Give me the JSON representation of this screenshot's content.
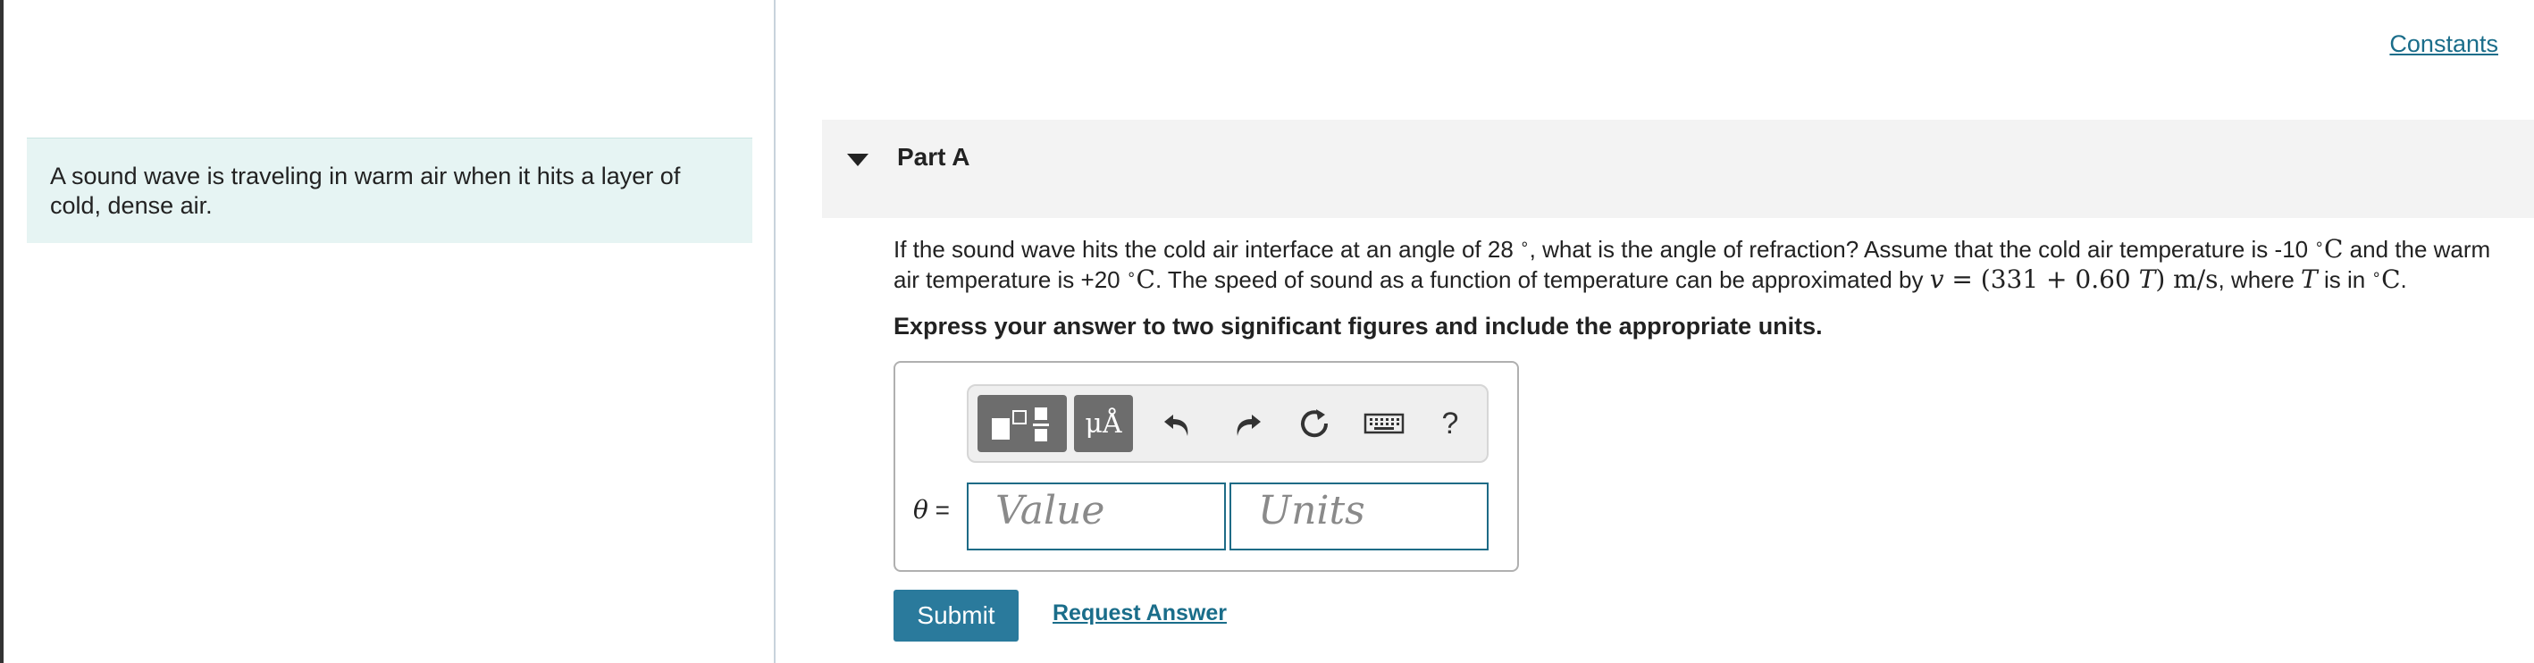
{
  "intro": {
    "text": "A sound wave is traveling in warm air when it hits a layer of cold, dense air."
  },
  "links": {
    "constants": "Constants"
  },
  "part": {
    "title": "Part A"
  },
  "question": {
    "text_1": "If the sound wave hits the cold air interface at an angle of 28 ",
    "degree_1": "∘",
    "text_2": ", what is the angle of refraction? Assume that the cold air temperature is -10 ",
    "unit_1": "C",
    "text_3": " and the warm air temperature is +20 ",
    "unit_2": "C",
    "text_4": ". The speed of sound as a function of temperature can be approximated by ",
    "formula_v": "v",
    "formula_body": " = (331 + 0.60 ",
    "formula_T": "T",
    "formula_units": ") m/s",
    "text_5": ", where ",
    "var_T": "T",
    "text_6": " is in ",
    "unit_3": "C",
    "text_7": ".",
    "instruction": "Express your answer to two significant figures and include the appropriate units."
  },
  "toolbar": {
    "symbols_label": "μÅ",
    "help_label": "?",
    "icons": [
      "templates-icon",
      "symbols-icon",
      "undo-icon",
      "redo-icon",
      "reset-icon",
      "keyboard-icon",
      "help-icon"
    ]
  },
  "answer": {
    "variable": "θ",
    "equals": " =",
    "value_placeholder": "Value",
    "units_placeholder": "Units"
  },
  "buttons": {
    "submit": "Submit",
    "request_answer": "Request Answer"
  },
  "colors": {
    "accent": "#2a7a9c",
    "link": "#1a6d8a",
    "intro_bg": "#e6f4f3",
    "header_bg": "#f3f3f3"
  }
}
